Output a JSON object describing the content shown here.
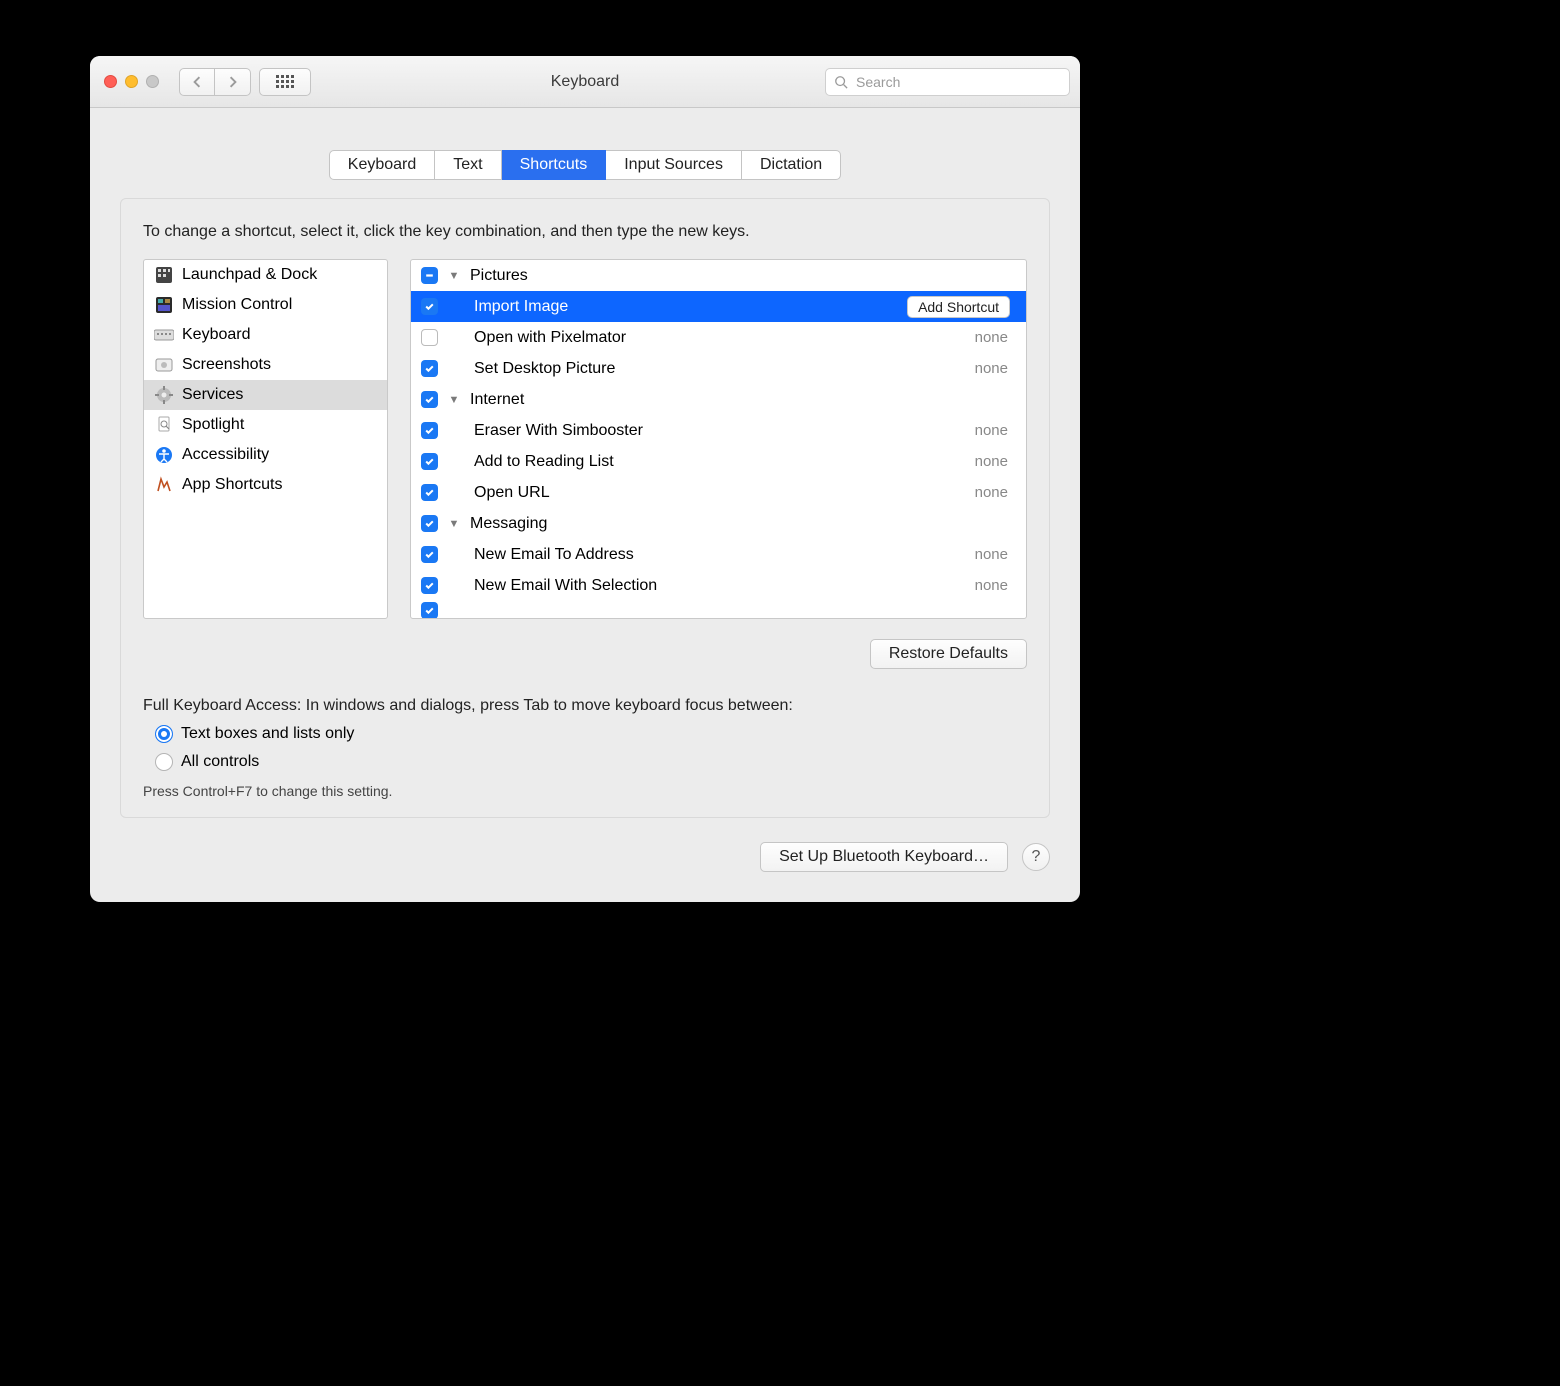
{
  "window": {
    "title": "Keyboard",
    "search_placeholder": "Search"
  },
  "tabs": [
    {
      "label": "Keyboard",
      "active": false
    },
    {
      "label": "Text",
      "active": false
    },
    {
      "label": "Shortcuts",
      "active": true
    },
    {
      "label": "Input Sources",
      "active": false
    },
    {
      "label": "Dictation",
      "active": false
    }
  ],
  "instruction": "To change a shortcut, select it, click the key combination, and then type the new keys.",
  "categories": [
    {
      "label": "Launchpad & Dock",
      "icon": "launchpad-icon",
      "selected": false
    },
    {
      "label": "Mission Control",
      "icon": "mission-control-icon",
      "selected": false
    },
    {
      "label": "Keyboard",
      "icon": "keyboard-icon",
      "selected": false
    },
    {
      "label": "Screenshots",
      "icon": "screenshots-icon",
      "selected": false
    },
    {
      "label": "Services",
      "icon": "services-icon",
      "selected": true
    },
    {
      "label": "Spotlight",
      "icon": "spotlight-icon",
      "selected": false
    },
    {
      "label": "Accessibility",
      "icon": "accessibility-icon",
      "selected": false
    },
    {
      "label": "App Shortcuts",
      "icon": "app-shortcuts-icon",
      "selected": false
    }
  ],
  "services": [
    {
      "kind": "group",
      "check": "mixed",
      "label": "Pictures"
    },
    {
      "kind": "item",
      "check": "checked",
      "label": "Import Image",
      "shortcut": "",
      "selected": true,
      "add_button": "Add Shortcut"
    },
    {
      "kind": "item",
      "check": "unchecked",
      "label": "Open with Pixelmator",
      "shortcut": "none"
    },
    {
      "kind": "item",
      "check": "checked",
      "label": "Set Desktop Picture",
      "shortcut": "none"
    },
    {
      "kind": "group",
      "check": "checked",
      "label": "Internet"
    },
    {
      "kind": "item",
      "check": "checked",
      "label": "Eraser With Simbooster",
      "shortcut": "none"
    },
    {
      "kind": "item",
      "check": "checked",
      "label": "Add to Reading List",
      "shortcut": "none"
    },
    {
      "kind": "item",
      "check": "checked",
      "label": "Open URL",
      "shortcut": "none"
    },
    {
      "kind": "group",
      "check": "checked",
      "label": "Messaging"
    },
    {
      "kind": "item",
      "check": "checked",
      "label": "New Email To Address",
      "shortcut": "none"
    },
    {
      "kind": "item",
      "check": "checked",
      "label": "New Email With Selection",
      "shortcut": "none"
    }
  ],
  "restore_defaults": "Restore Defaults",
  "fka": {
    "label": "Full Keyboard Access: In windows and dialogs, press Tab to move keyboard focus between:",
    "opt1": "Text boxes and lists only",
    "opt2": "All controls",
    "hint": "Press Control+F7 to change this setting."
  },
  "footer": {
    "bluetooth": "Set Up Bluetooth Keyboard…",
    "help": "?"
  }
}
